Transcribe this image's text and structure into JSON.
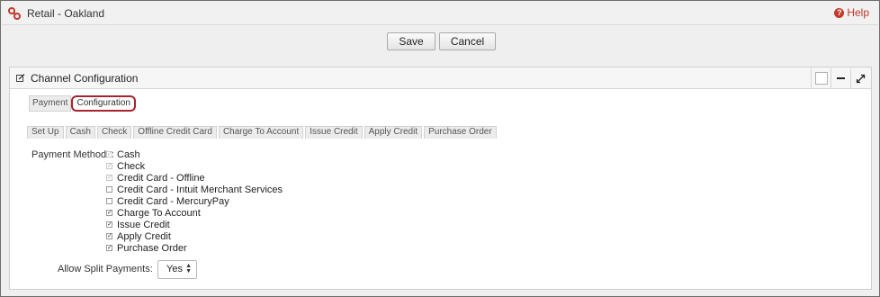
{
  "app": {
    "title": "Retail - Oakland",
    "help_label": "Help"
  },
  "toolbar": {
    "save_label": "Save",
    "cancel_label": "Cancel"
  },
  "panel": {
    "title": "Channel Configuration",
    "subtabs": [
      {
        "label": "Payment",
        "active": false
      },
      {
        "label": "Configuration",
        "active": true
      }
    ],
    "tabs": [
      "Set Up",
      "Cash",
      "Check",
      "Offline Credit Card",
      "Charge To Account",
      "Issue Credit",
      "Apply Credit",
      "Purchase Order"
    ],
    "payment_methods_label": "Payment Methods:",
    "payment_methods": [
      {
        "label": "Cash",
        "checked": true,
        "disabled": true
      },
      {
        "label": "Check",
        "checked": true,
        "disabled": true
      },
      {
        "label": "Credit Card - Offline",
        "checked": true,
        "disabled": true
      },
      {
        "label": "Credit Card - Intuit Merchant Services",
        "checked": false,
        "disabled": false
      },
      {
        "label": "Credit Card - MercuryPay",
        "checked": false,
        "disabled": false
      },
      {
        "label": "Charge To Account",
        "checked": true,
        "disabled": false
      },
      {
        "label": "Issue Credit",
        "checked": true,
        "disabled": false
      },
      {
        "label": "Apply Credit",
        "checked": true,
        "disabled": false
      },
      {
        "label": "Purchase Order",
        "checked": true,
        "disabled": false
      }
    ],
    "split_payments_label": "Allow Split Payments:",
    "split_payments_value": "Yes"
  },
  "icons": {
    "app": "link-icon",
    "help": "help-icon",
    "panel_edit": "edit-icon",
    "window_square": "square-icon",
    "minimize": "minimize-icon",
    "expand": "expand-icon",
    "select_arrows": "updown-arrows-icon"
  },
  "colors": {
    "accent": "#c0392b",
    "active_tab_border": "#a8242c"
  }
}
